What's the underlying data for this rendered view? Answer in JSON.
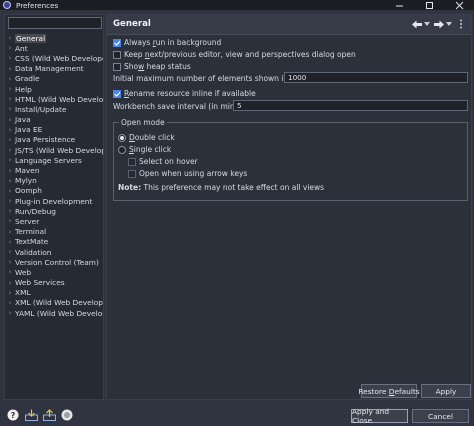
{
  "window": {
    "title": "Preferences"
  },
  "filter": {
    "value": "",
    "placeholder": ""
  },
  "tree": [
    {
      "label": "General",
      "expandable": true,
      "selected": true
    },
    {
      "label": "Ant",
      "expandable": true
    },
    {
      "label": "CSS (Wild Web Developer)",
      "expandable": true
    },
    {
      "label": "Data Management",
      "expandable": true
    },
    {
      "label": "Gradle",
      "expandable": true
    },
    {
      "label": "Help",
      "expandable": true
    },
    {
      "label": "HTML (Wild Web Develope",
      "expandable": true
    },
    {
      "label": "Install/Update",
      "expandable": true
    },
    {
      "label": "Java",
      "expandable": true
    },
    {
      "label": "Java EE",
      "expandable": true
    },
    {
      "label": "Java Persistence",
      "expandable": true
    },
    {
      "label": "JS/TS (Wild Web Develope",
      "expandable": true
    },
    {
      "label": "Language Servers",
      "expandable": true
    },
    {
      "label": "Maven",
      "expandable": true
    },
    {
      "label": "Mylyn",
      "expandable": true
    },
    {
      "label": "Oomph",
      "expandable": true
    },
    {
      "label": "Plug-in Development",
      "expandable": true
    },
    {
      "label": "Run/Debug",
      "expandable": true
    },
    {
      "label": "Server",
      "expandable": true
    },
    {
      "label": "Terminal",
      "expandable": true
    },
    {
      "label": "TextMate",
      "expandable": true
    },
    {
      "label": "Validation",
      "expandable": true
    },
    {
      "label": "Version Control (Team)",
      "expandable": true
    },
    {
      "label": "Web",
      "expandable": true
    },
    {
      "label": "Web Services",
      "expandable": true
    },
    {
      "label": "XML",
      "expandable": true
    },
    {
      "label": "XML (Wild Web Developer)",
      "expandable": true
    },
    {
      "label": "YAML (Wild Web Develope",
      "expandable": true
    }
  ],
  "page": {
    "title": "General",
    "always_run_pre": "Always ",
    "always_run_u": "r",
    "always_run_post": "un in background",
    "keep_next_pre": "Keep ",
    "keep_next_u": "n",
    "keep_next_post": "ext/previous editor, view and perspectives dialog open",
    "show_heap_pre": "Sho",
    "show_heap_u": "w",
    "show_heap_post": " heap status",
    "max_elements_label": "Initial maximum number of elements shown in views:",
    "max_elements_value": "1000",
    "rename_pre": "",
    "rename_u": "R",
    "rename_post": "ename resource inline if available",
    "autosave_label": "Workbench save interval (in minutes):",
    "autosave_value": "5",
    "open_mode_legend": "Open mode",
    "double_click_pre": "",
    "double_click_u": "D",
    "double_click_post": "ouble click",
    "single_click_pre": "",
    "single_click_u": "S",
    "single_click_post": "ingle click",
    "select_hover": "Select on hover",
    "open_arrow": "Open when using arrow keys",
    "note_bold": "Note:",
    "note_text": " This preference may not take effect on all views"
  },
  "buttons": {
    "restore_pre": "Restore ",
    "restore_u": "D",
    "restore_post": "efaults",
    "apply": "Apply",
    "apply_close": "Apply and Close",
    "cancel": "Cancel"
  },
  "colors": {
    "accent": "#4a86e8",
    "background": "#2f3440",
    "panel": "#2b303b"
  }
}
